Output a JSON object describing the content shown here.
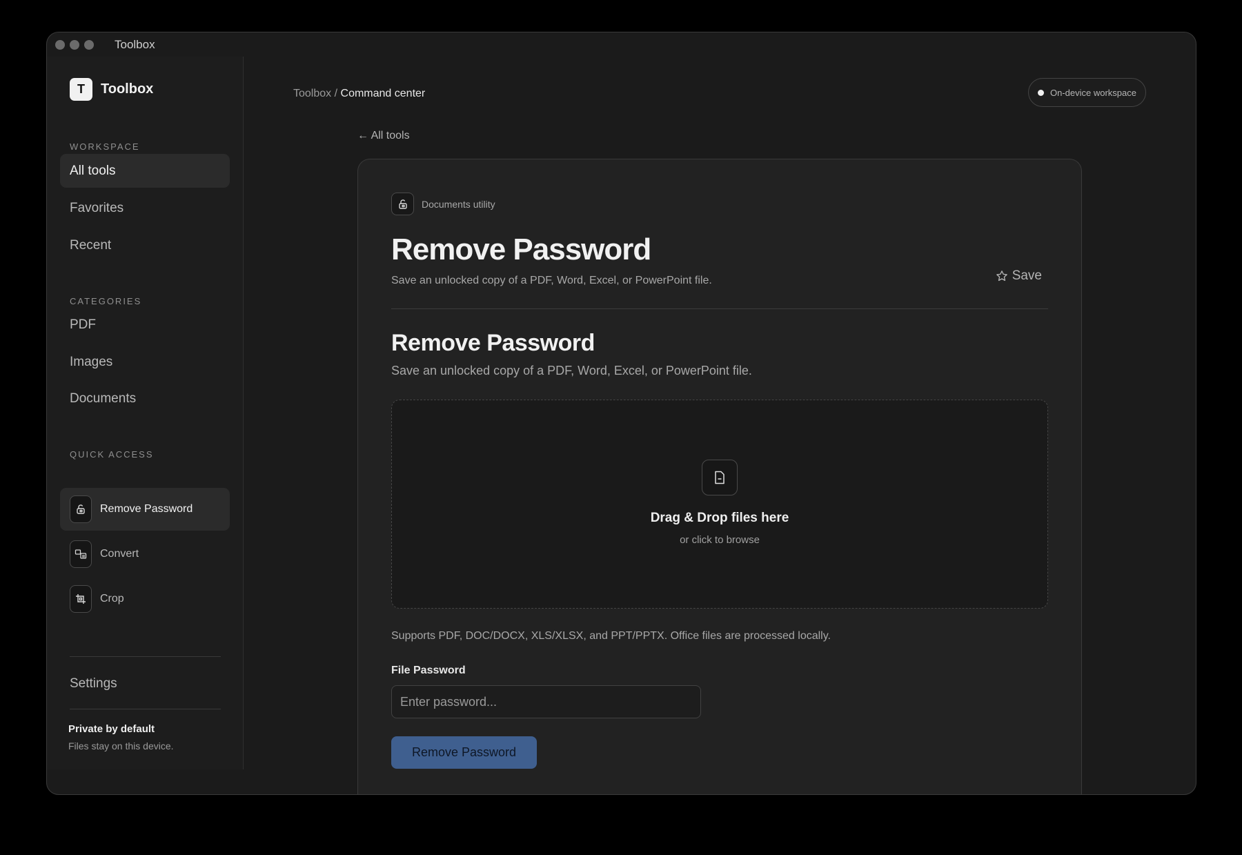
{
  "window": {
    "title": "Toolbox"
  },
  "sidebar": {
    "brand_letter": "T",
    "brand_name": "Toolbox",
    "workspace_label": "WORKSPACE",
    "workspace_items": [
      {
        "label": "All tools",
        "active": true
      },
      {
        "label": "Favorites",
        "active": false
      },
      {
        "label": "Recent",
        "active": false
      }
    ],
    "categories_label": "CATEGORIES",
    "category_items": [
      {
        "label": "PDF"
      },
      {
        "label": "Images"
      },
      {
        "label": "Documents"
      }
    ],
    "quick_access_label": "QUICK ACCESS",
    "quick_access_items": [
      {
        "label": "Remove Password",
        "icon": "unlock-icon",
        "active": true
      },
      {
        "label": "Convert",
        "icon": "convert-icon",
        "active": false
      },
      {
        "label": "Crop",
        "icon": "crop-icon",
        "active": false
      }
    ],
    "settings_label": "Settings",
    "privacy_title": "Private by default",
    "privacy_subtitle": "Files stay on this device."
  },
  "header": {
    "breadcrumb_root": "Toolbox",
    "breadcrumb_separator": "/",
    "breadcrumb_current": "Command center",
    "status_label": "On-device workspace"
  },
  "main": {
    "back_link": "← All tools",
    "kicker": "Documents utility",
    "title": "Remove Password",
    "subtitle": "Save an unlocked copy of a PDF, Word, Excel, or PowerPoint file.",
    "save_label": "Save",
    "tool_title": "Remove Password",
    "tool_subtitle": "Save an unlocked copy of a PDF, Word, Excel, or PowerPoint file.",
    "dropzone_title": "Drag & Drop files here",
    "dropzone_subtitle": "or click to browse",
    "support_note": "Supports PDF, DOC/DOCX, XLS/XLSX, and PPT/PPTX. Office files are processed locally.",
    "password_label": "File Password",
    "password_placeholder": "Enter password...",
    "password_value": "",
    "submit_label": "Remove Password"
  },
  "colors": {
    "background": "#1b1b1b",
    "card": "#222222",
    "accent_button": "#3f5f8f"
  }
}
